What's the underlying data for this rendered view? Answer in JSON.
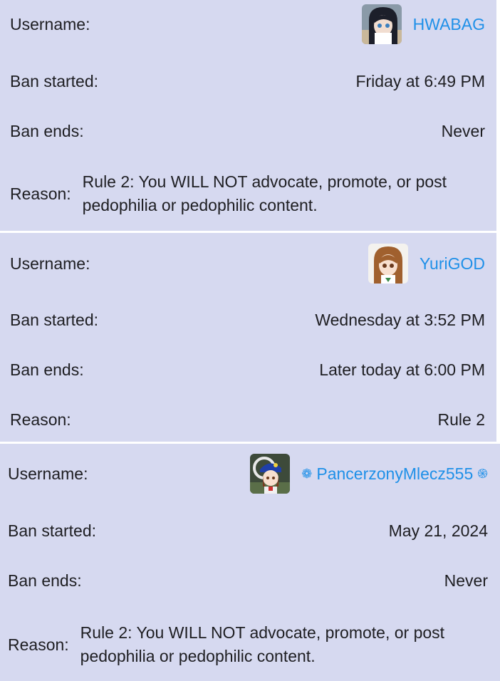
{
  "bans": [
    {
      "username_label": "Username:",
      "username": "HWABAG",
      "username_prefix": "",
      "username_suffix": "",
      "avatar_icon": "anime-avatar-dark-hair-icon",
      "started_label": "Ban started:",
      "started": "Friday at 6:49 PM",
      "ends_label": "Ban ends:",
      "ends": "Never",
      "reason_label": "Reason:",
      "reason": "Rule 2: You WILL NOT advocate, promote, or post pedophilia or pedophilic content."
    },
    {
      "username_label": "Username:",
      "username": "YuriGOD",
      "username_prefix": "",
      "username_suffix": "",
      "avatar_icon": "anime-avatar-brown-hair-icon",
      "started_label": "Ban started:",
      "started": "Wednesday at 3:52 PM",
      "ends_label": "Ban ends:",
      "ends": "Later today at 6:00 PM",
      "reason_label": "Reason:",
      "reason": "Rule 2"
    },
    {
      "username_label": "Username:",
      "username": "PancerzonyMlecz555",
      "username_prefix": "❁",
      "username_suffix": "֍",
      "avatar_icon": "anime-avatar-blue-cap-icon",
      "started_label": "Ban started:",
      "started": "May 21, 2024",
      "ends_label": "Ban ends:",
      "ends": "Never",
      "reason_label": "Reason:",
      "reason": "Rule 2: You WILL NOT advocate, promote, or post pedophilia or pedophilic content."
    }
  ],
  "colors": {
    "card_background": "#d6d9f0",
    "username_link": "#1f90e8",
    "text": "#1e1e22",
    "divider": "#ffffff"
  }
}
